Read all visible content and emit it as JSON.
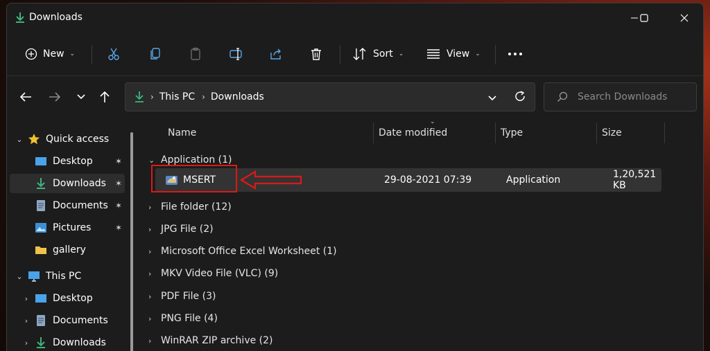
{
  "window": {
    "title": "Downloads"
  },
  "toolbar": {
    "new_label": "New",
    "sort_label": "Sort",
    "view_label": "View"
  },
  "address": {
    "crumbs": [
      "This PC",
      "Downloads"
    ]
  },
  "search": {
    "placeholder": "Search Downloads"
  },
  "sidebar": {
    "quick_access": "Quick access",
    "quick_items": [
      "Desktop",
      "Downloads",
      "Documents",
      "Pictures",
      "gallery"
    ],
    "this_pc": "This PC",
    "pc_items": [
      "Desktop",
      "Documents",
      "Downloads"
    ]
  },
  "columns": {
    "name": "Name",
    "date": "Date modified",
    "type": "Type",
    "size": "Size"
  },
  "groups": [
    "Application (1)",
    "File folder (12)",
    "JPG File (2)",
    "Microsoft Office Excel Worksheet (1)",
    "MKV Video File (VLC) (9)",
    "PDF File (3)",
    "PNG File (4)",
    "WinRAR ZIP archive (2)"
  ],
  "file": {
    "name": "MSERT",
    "date": "29-08-2021 07:39",
    "type": "Application",
    "size": "1,20,521 KB"
  },
  "colors": {
    "accent_green": "#3fb37f",
    "highlight_red": "#e01818",
    "window_bg": "#1c1c1c"
  }
}
